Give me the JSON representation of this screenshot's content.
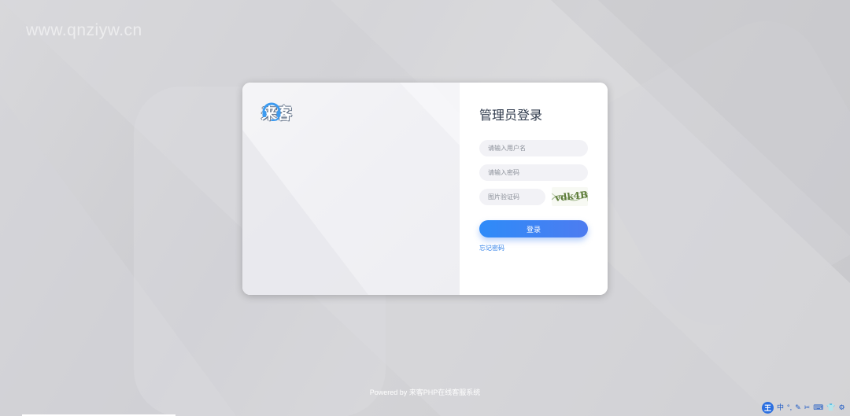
{
  "watermark": "www.qnziyw.cn",
  "brand": {
    "name": "来客",
    "logo_icon": "headset-icon"
  },
  "login": {
    "title": "管理员登录",
    "username_placeholder": "请输入用户名",
    "password_placeholder": "请输入密码",
    "captcha_placeholder": "图片验证码",
    "captcha_text": "vdk4B",
    "submit_label": "登录",
    "forgot_label": "忘记密码"
  },
  "footer": {
    "text": "Powered by 来客PHP在线客服系统"
  },
  "ime_toolbar": {
    "logo": "王",
    "items": [
      "中",
      "°,",
      "✎",
      "✂",
      "⌨",
      "👕",
      "⚙"
    ]
  },
  "colors": {
    "accent": "#2e8bf8",
    "title": "#2f3a4c",
    "link": "#2f7fe8"
  }
}
